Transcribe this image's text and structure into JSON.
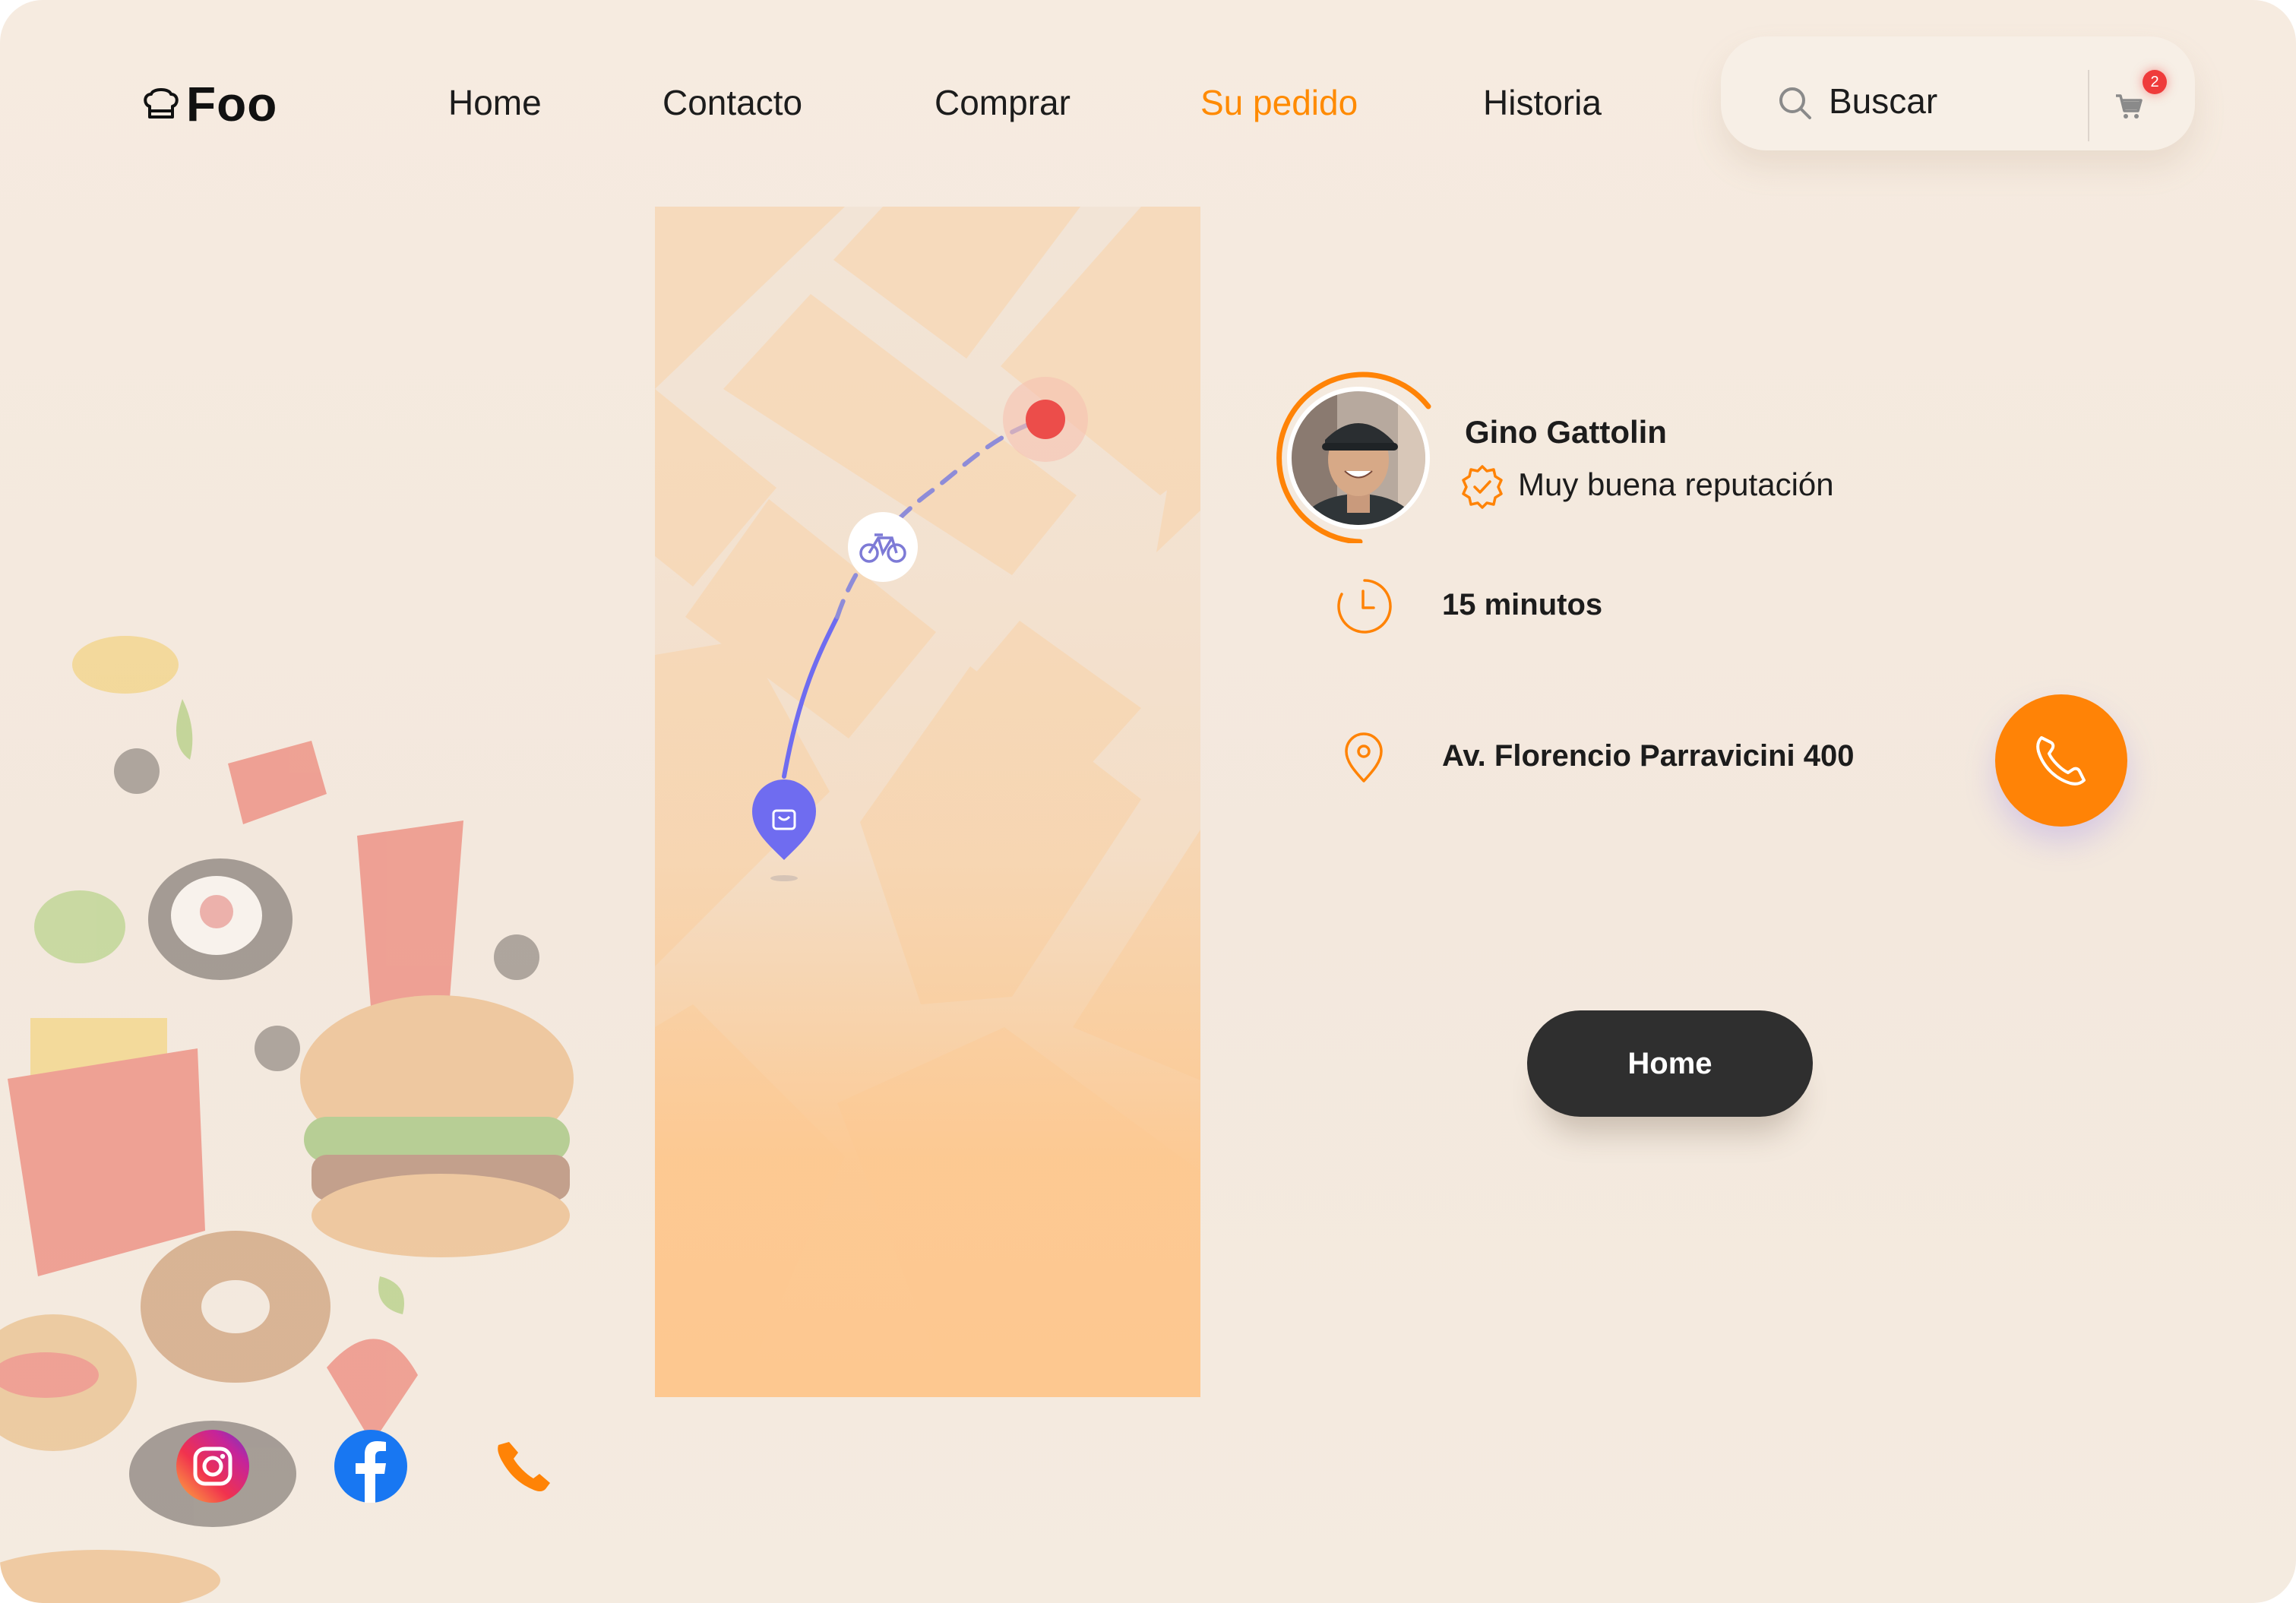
{
  "brand": {
    "name": "Foo",
    "icon": "chef-hat-icon"
  },
  "nav": {
    "items": [
      {
        "label": "Home"
      },
      {
        "label": "Contacto"
      },
      {
        "label": "Comprar"
      },
      {
        "label": "Su pedido",
        "active": true
      },
      {
        "label": "Historia"
      }
    ]
  },
  "search": {
    "placeholder": "Buscar",
    "icon": "search-icon"
  },
  "cart": {
    "count": "2",
    "icon": "cart-icon"
  },
  "courier": {
    "name": "Gino Gattolin",
    "reputation": "Muy buena reputación"
  },
  "delivery": {
    "eta": "15 minutos",
    "address": "Av.  Florencio Parravicini 400"
  },
  "actions": {
    "home_label": "Home",
    "call_icon": "phone-icon"
  },
  "socials": [
    {
      "icon": "instagram-icon"
    },
    {
      "icon": "facebook-icon"
    },
    {
      "icon": "phone-icon"
    }
  ],
  "colors": {
    "accent": "#ff8306",
    "route": "#6f6cf0",
    "destination": "#ec4d4a",
    "dark_button": "#2f2f2f",
    "map_block": "#f8d8b0"
  }
}
